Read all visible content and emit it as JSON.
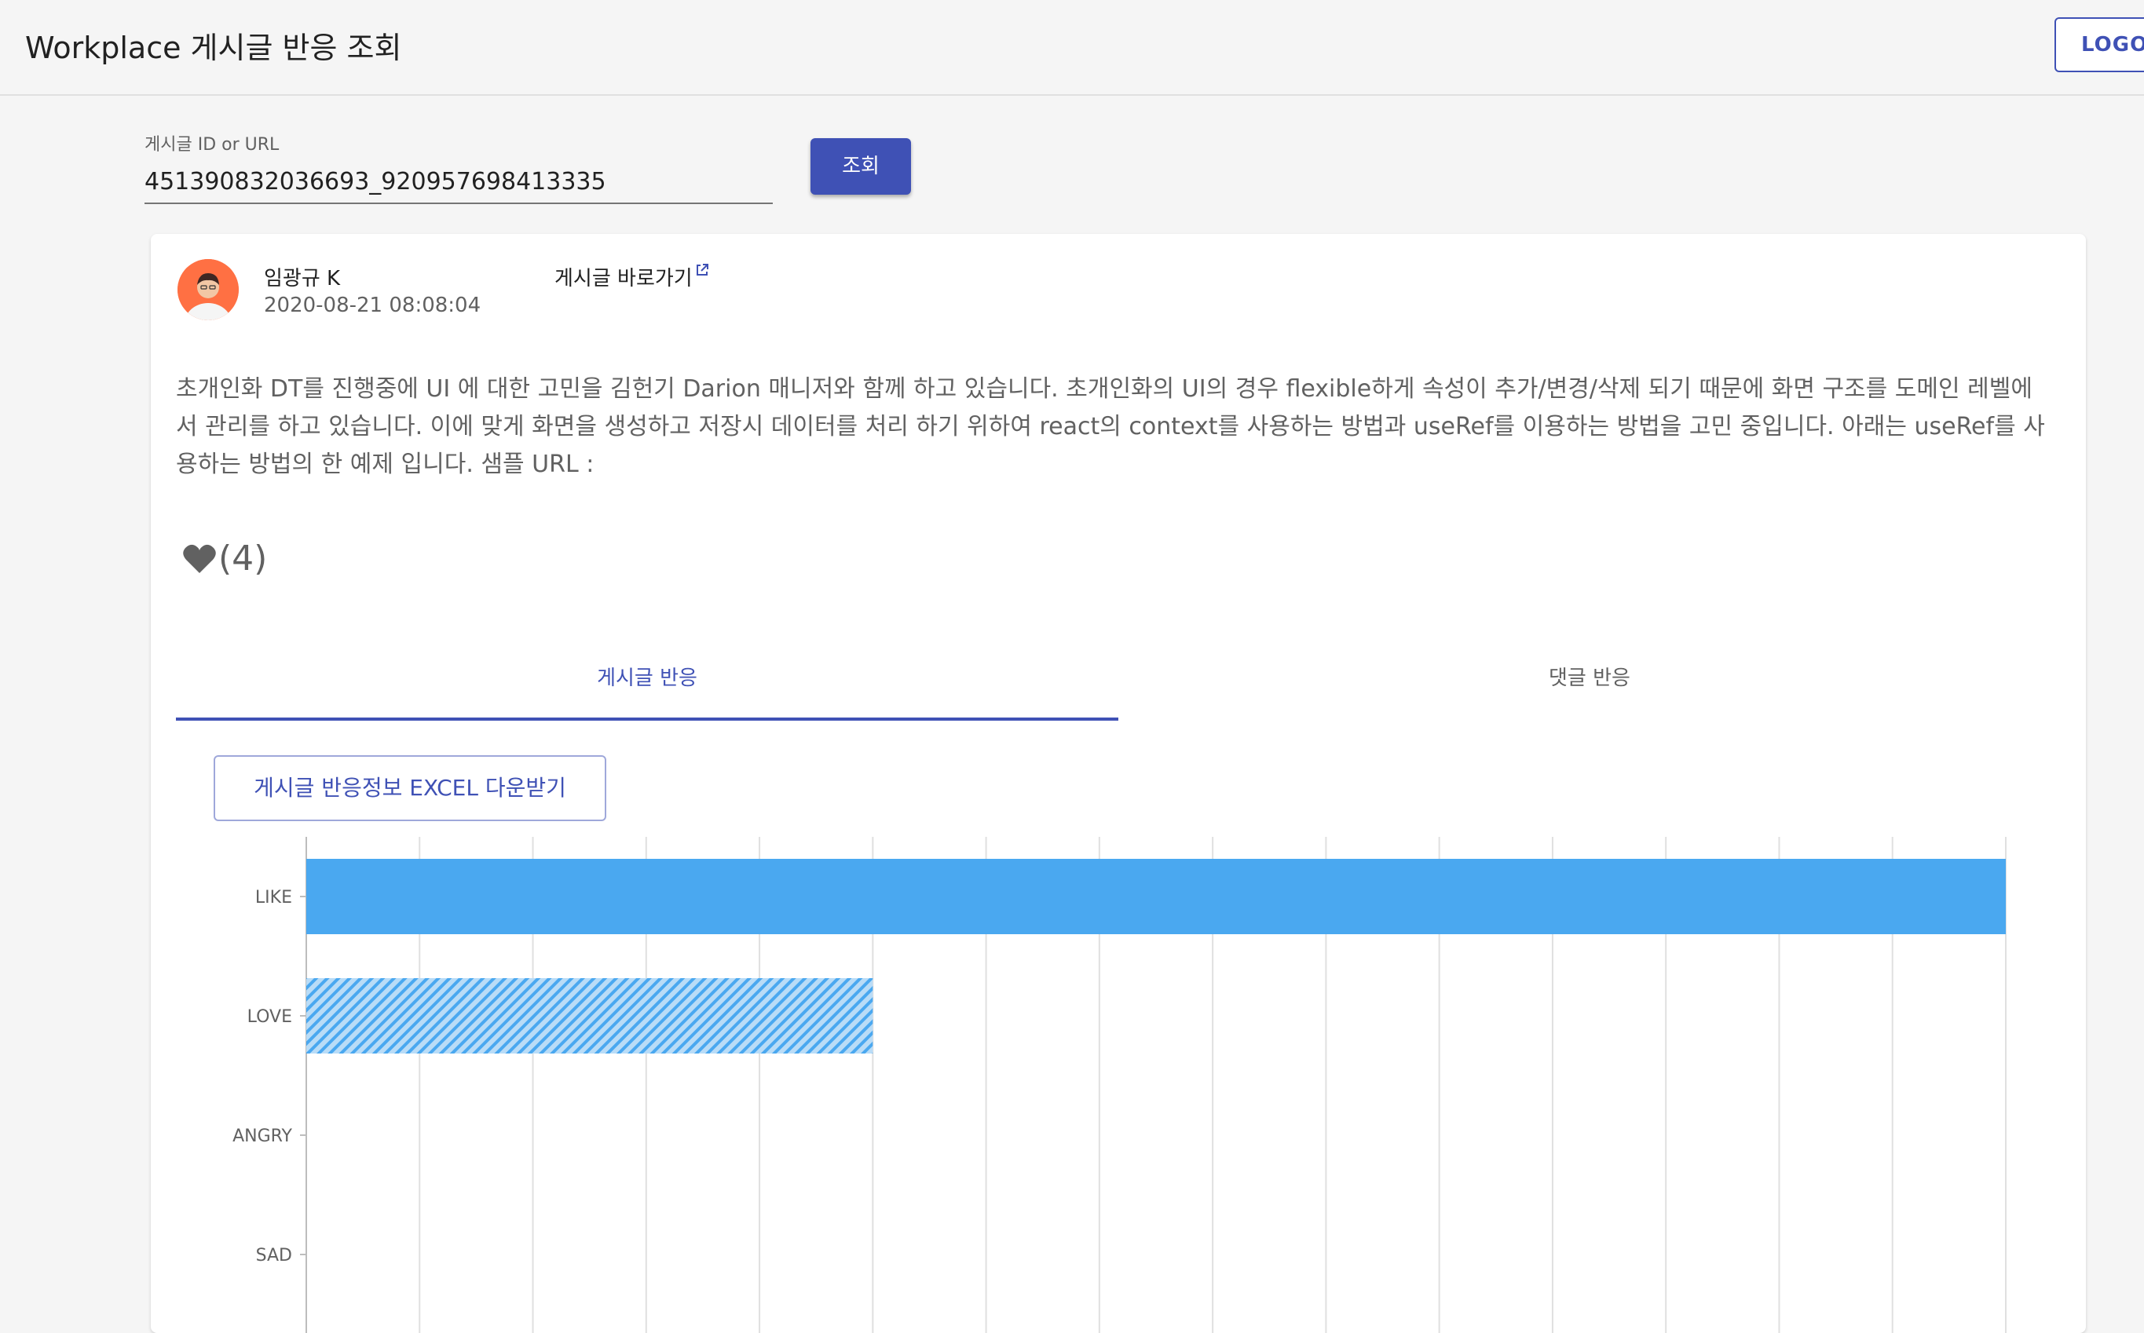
{
  "app": {
    "title": "Workplace 게시글 반응 조회",
    "logout_label": "LOGOUT"
  },
  "search": {
    "label": "게시글 ID or URL",
    "value": "451390832036693_920957698413335",
    "button_label": "조회"
  },
  "post": {
    "author": "임광규 K",
    "date": "2020-08-21 08:08:04",
    "link_label": "게시글 바로가기",
    "body": "초개인화 DT를 진행중에 UI 에 대한 고민을 김헌기 Darion 매니저와 함께 하고 있습니다. 초개인화의 UI의 경우 flexible하게 속성이 추가/변경/삭제 되기 때문에 화면 구조를 도메인 레벨에서 관리를 하고 있습니다. 이에 맞게 화면을 생성하고 저장시 데이터를 처리 하기 위하여 react의 context를 사용하는 방법과 useRef를 이용하는 방법을 고민 중입니다. 아래는 useRef를 사용하는 방법의 한 예제 입니다. 샘플 URL :",
    "like_count": "(4)"
  },
  "tabs": [
    {
      "label": "게시글 반응",
      "active": true
    },
    {
      "label": "댓글 반응",
      "active": false
    }
  ],
  "excel_button_label": "게시글 반응정보 EXCEL 다운받기",
  "colors": {
    "primary": "#3f51b5",
    "bar": "#4aa8f0"
  },
  "chart_data": {
    "type": "bar",
    "orientation": "horizontal",
    "categories": [
      "LIKE",
      "LOVE",
      "ANGRY",
      "SAD"
    ],
    "values": [
      3,
      1,
      0,
      0
    ],
    "xlim": [
      0,
      3
    ],
    "grid": true,
    "series": [
      {
        "values": [
          3,
          1,
          0,
          0
        ]
      }
    ]
  }
}
